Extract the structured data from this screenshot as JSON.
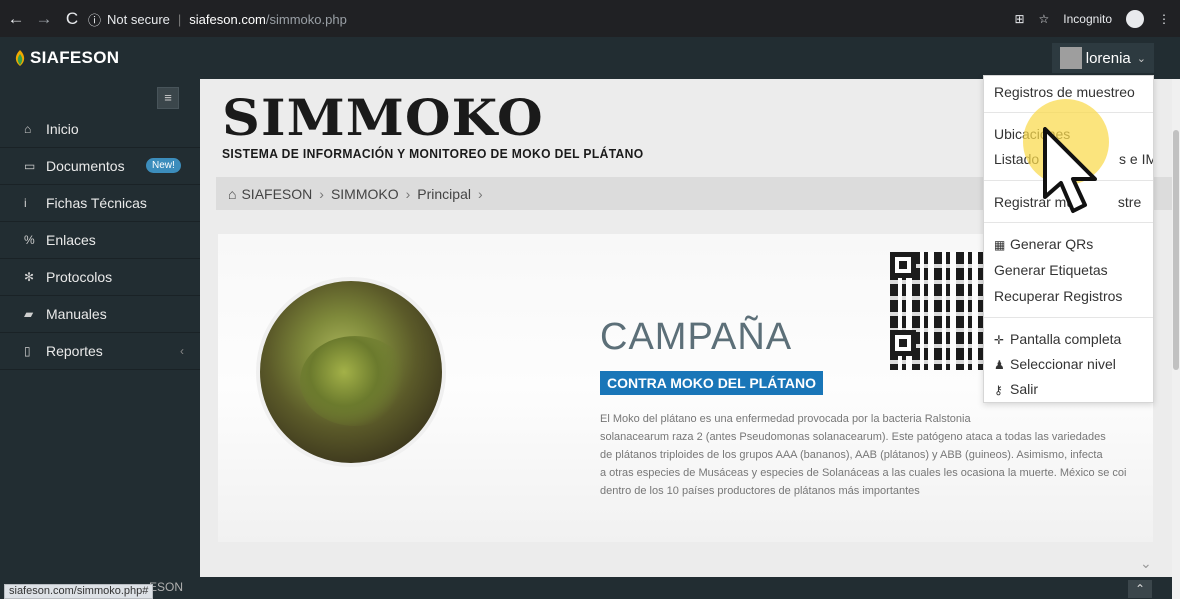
{
  "browser": {
    "address": {
      "security": "Not secure",
      "host": "siafeson.com",
      "path": "/simmoko.php"
    },
    "incognito_label": "Incognito"
  },
  "header": {
    "brand": "SIAFESON",
    "user": "lorenia"
  },
  "sidebar": {
    "items": [
      {
        "label": "Inicio",
        "icon": "home-icon"
      },
      {
        "label": "Documentos",
        "icon": "folder-icon",
        "badge": "New!"
      },
      {
        "label": "Fichas Técnicas",
        "icon": "info-icon"
      },
      {
        "label": "Enlaces",
        "icon": "link-icon"
      },
      {
        "label": "Protocolos",
        "icon": "gear-icon"
      },
      {
        "label": "Manuales",
        "icon": "book-icon"
      },
      {
        "label": "Reportes",
        "icon": "file-icon"
      }
    ]
  },
  "main": {
    "logo_title": "SIMMOKO",
    "logo_subtitle": "SISTEMA DE INFORMACIÓN Y MONITOREO DE MOKO DEL PLÁTANO",
    "breadcrumb": [
      "SIAFESON",
      "SIMMOKO",
      "Principal"
    ],
    "hero": {
      "heading": "CAMPAÑA",
      "tag": "CONTRA MOKO DEL PLÁTANO",
      "description_lines": [
        "El Moko del plátano es una enfermedad provocada por la bacteria Ralstonia",
        "solanacearum raza 2 (antes Pseudomonas solanacearum). Este patógeno ataca a todas las variedades",
        "de plátanos triploides de los grupos AAA (bananos), AAB (plátanos) y ABB (guineos). Asimismo, infecta",
        "a otras especies de Musáceas y especies de Solanáceas a las cuales les ocasiona la muerte. México se coi",
        "dentro de los 10 países productores de plátanos más importantes"
      ]
    }
  },
  "dropdown": {
    "items": [
      "Registros de muestreo",
      "Ubicaciones",
      "Listado de Te",
      "s e IMEI",
      "Registrar mue",
      "stre",
      "Generar QRs",
      "Generar Etiquetas",
      "Recuperar Registros",
      "Pantalla completa",
      "Seleccionar nivel",
      "Salir"
    ]
  },
  "footer": {
    "status_url": "siafeson.com/simmoko.php#",
    "text": "ESON"
  },
  "colors": {
    "header_bg": "#222d32",
    "accent": "#3c8dbc",
    "tag_bg": "#1976b8",
    "highlight": "#f9d94b"
  }
}
